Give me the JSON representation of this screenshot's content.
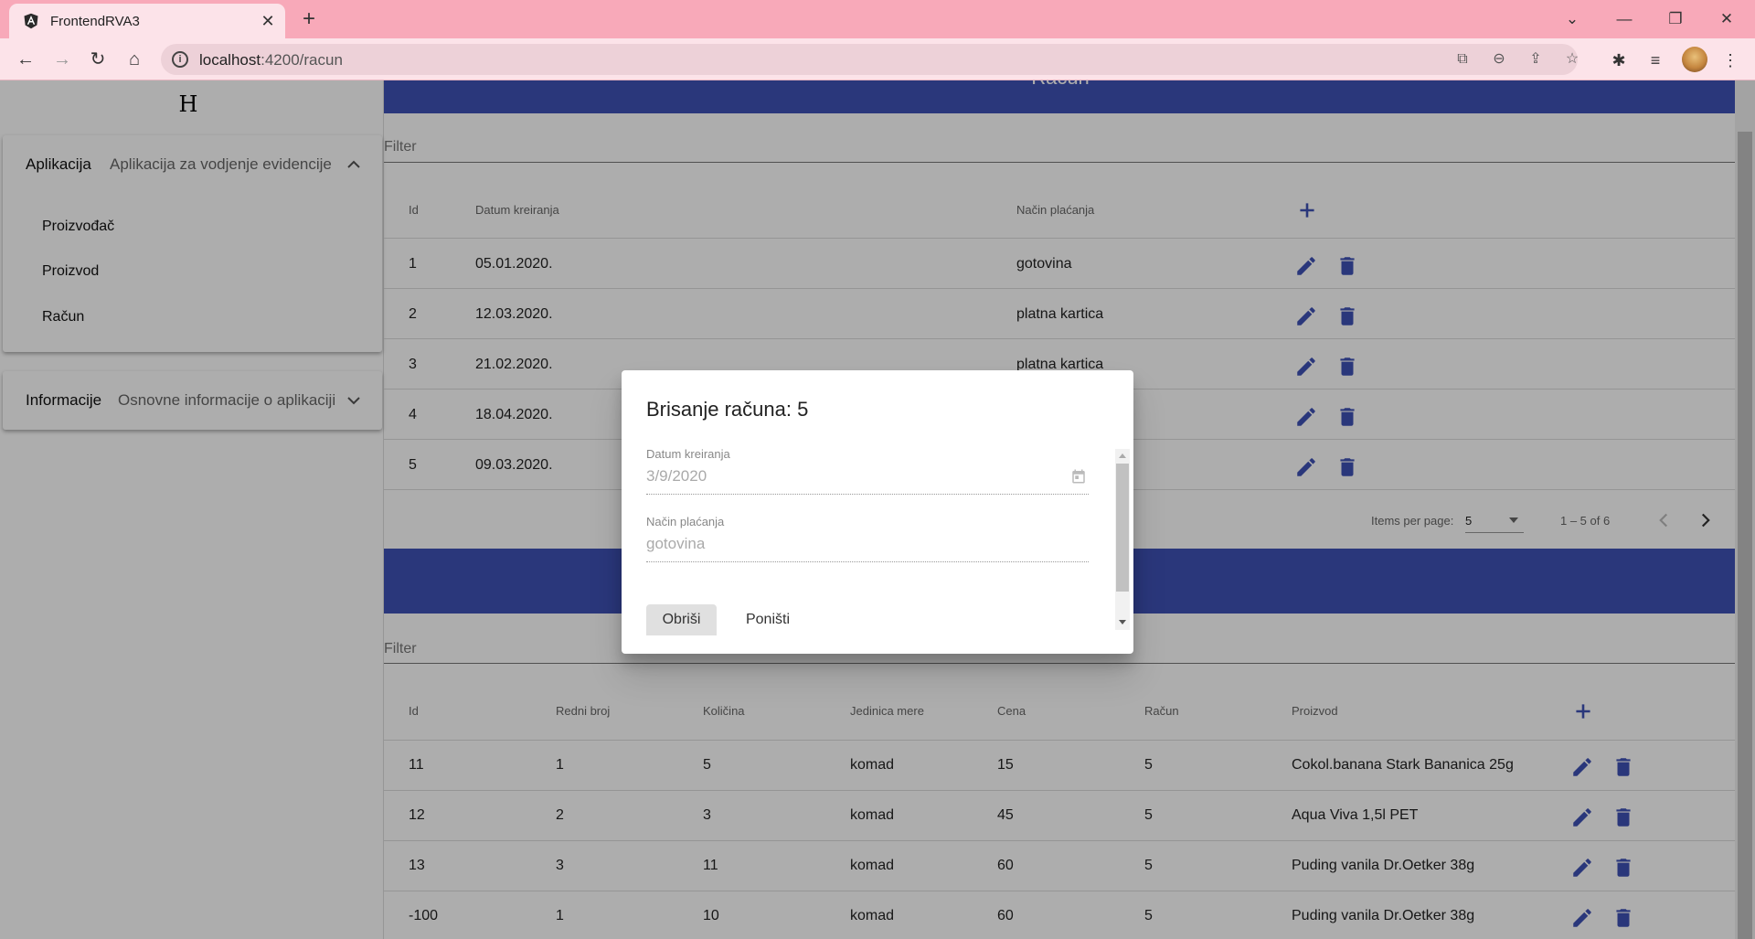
{
  "browser": {
    "tab_title": "FrontendRVA3",
    "url_host": "localhost",
    "url_rest": ":4200/racun"
  },
  "sidebar": {
    "logo": "H",
    "panels": [
      {
        "title": "Aplikacija",
        "description": "Aplikacija za vodjenje evidencije",
        "expanded": true,
        "items": [
          {
            "label": "Proizvođač"
          },
          {
            "label": "Proizvod"
          },
          {
            "label": "Račun"
          }
        ]
      },
      {
        "title": "Informacije",
        "description": "Osnovne informacije o aplikaciji",
        "expanded": false
      }
    ]
  },
  "racun_table": {
    "title": "Račun",
    "filter_placeholder": "Filter",
    "columns": [
      "Id",
      "Datum kreiranja",
      "Način plaćanja"
    ],
    "rows": [
      [
        "1",
        "05.01.2020.",
        "gotovina"
      ],
      [
        "2",
        "12.03.2020.",
        "platna kartica"
      ],
      [
        "3",
        "21.02.2020.",
        "platna kartica"
      ],
      [
        "4",
        "18.04.2020.",
        ""
      ],
      [
        "5",
        "09.03.2020.",
        ""
      ]
    ],
    "paginator": {
      "items_per_page_label": "Items per page:",
      "page_size": "5",
      "range": "1 – 5 of 6"
    }
  },
  "stavka_table": {
    "filter_placeholder": "Filter",
    "columns": [
      "Id",
      "Redni broj",
      "Količina",
      "Jedinica mere",
      "Cena",
      "Račun",
      "Proizvod"
    ],
    "rows": [
      [
        "11",
        "1",
        "5",
        "komad",
        "15",
        "5",
        "Cokol.banana Stark Bananica 25g"
      ],
      [
        "12",
        "2",
        "3",
        "komad",
        "45",
        "5",
        "Aqua Viva 1,5l PET"
      ],
      [
        "13",
        "3",
        "11",
        "komad",
        "60",
        "5",
        "Puding vanila Dr.Oetker 38g"
      ],
      [
        "-100",
        "1",
        "10",
        "komad",
        "60",
        "5",
        "Puding vanila Dr.Oetker 38g"
      ]
    ]
  },
  "dialog": {
    "title": "Brisanje računa: 5",
    "date_label": "Datum kreiranja",
    "date_value": "3/9/2020",
    "payment_label": "Način plaćanja",
    "payment_value": "gotovina",
    "delete_label": "Obriši",
    "cancel_label": "Poništi"
  },
  "colors": {
    "accent": "#3f51b5",
    "tabbar": "#f8a9b9",
    "toolbar": "#fce3e9"
  }
}
